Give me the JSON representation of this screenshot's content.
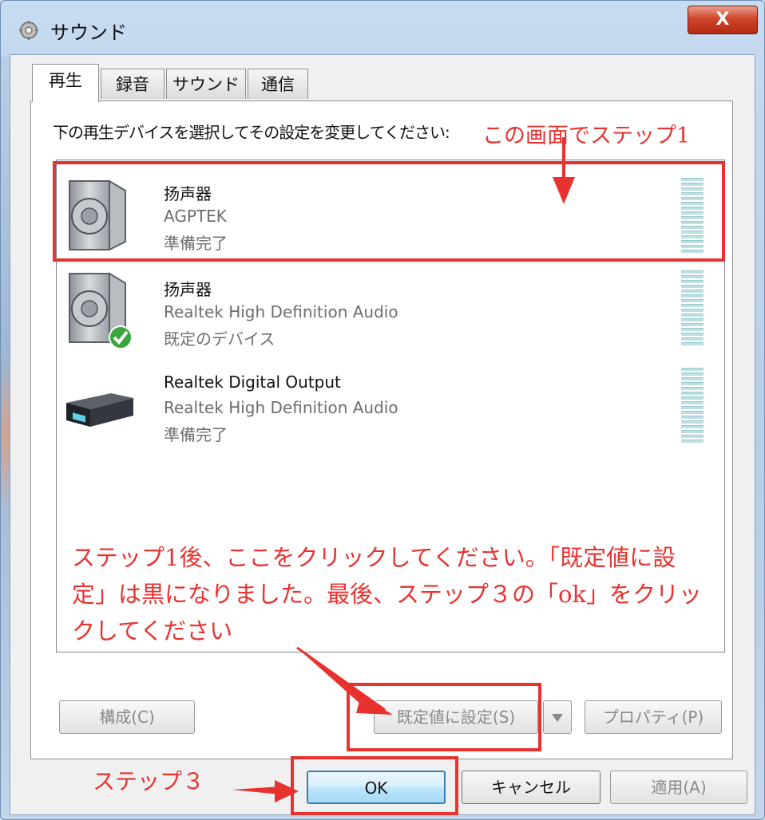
{
  "window": {
    "title": "サウンド",
    "close_label": "X",
    "title_icon": "speaker-settings-icon"
  },
  "tabs": [
    {
      "label": "再生",
      "active": true
    },
    {
      "label": "録音",
      "active": false
    },
    {
      "label": "サウンド",
      "active": false
    },
    {
      "label": "通信",
      "active": false
    }
  ],
  "instruction": "下の再生デバイスを選択してその設定を変更してください:",
  "devices": [
    {
      "name": "扬声器",
      "description": "AGPTEK",
      "status": "準備完了",
      "icon": "speaker-icon"
    },
    {
      "name": "扬声器",
      "description": "Realtek High Definition Audio",
      "status": "既定のデバイス",
      "icon": "speaker-default-icon"
    },
    {
      "name": "Realtek Digital Output",
      "description": "Realtek High Definition Audio",
      "status": "準備完了",
      "icon": "digital-receiver-icon"
    }
  ],
  "buttons": {
    "configure": "構成(C)",
    "set_default": "既定値に設定(S)",
    "properties": "プロパティ(P)",
    "ok": "OK",
    "cancel": "キャンセル",
    "apply": "適用(A)"
  },
  "annotations": {
    "step1": "この画面でステップ1",
    "step2_line1": "ステップ1後、ここをクリックしてください。「既定値に設",
    "step2_line2": "定」は黒になりました。最後、ステップ３の「ok」をクリッ",
    "step2_line3": "クしてください",
    "step3": "ステップ３"
  },
  "colors": {
    "annotation_red": "#e8322f",
    "ok_border": "#3c7fb1",
    "close_red": "#c8381d"
  }
}
